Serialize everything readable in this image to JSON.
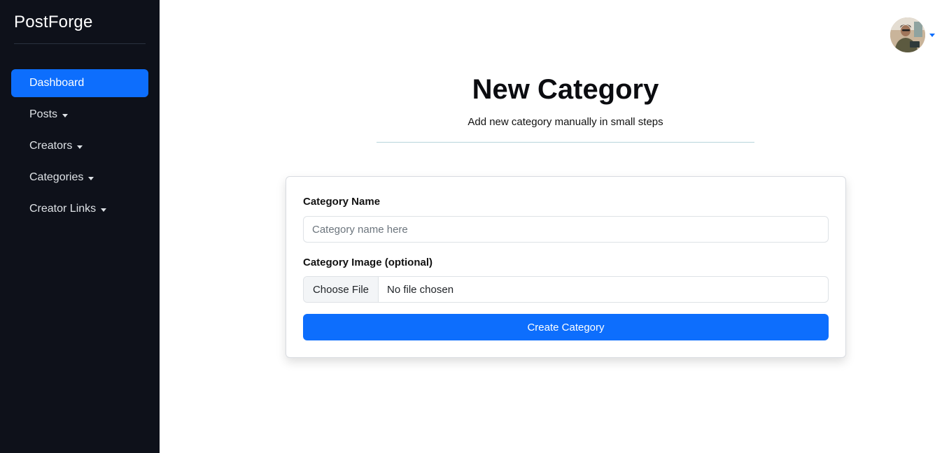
{
  "app": {
    "brand": "PostForge"
  },
  "sidebar": {
    "items": [
      {
        "label": "Dashboard",
        "active": true,
        "has_dropdown": false
      },
      {
        "label": "Posts",
        "active": false,
        "has_dropdown": true
      },
      {
        "label": "Creators",
        "active": false,
        "has_dropdown": true
      },
      {
        "label": "Categories",
        "active": false,
        "has_dropdown": true
      },
      {
        "label": "Creator Links",
        "active": false,
        "has_dropdown": true
      }
    ]
  },
  "header": {
    "title": "New Category",
    "subtitle": "Add new category manually in small steps"
  },
  "form": {
    "name_label": "Category Name",
    "name_placeholder": "Category name here",
    "name_value": "",
    "image_label": "Category Image (optional)",
    "file_button": "Choose File",
    "file_status": "No file chosen",
    "submit_label": "Create Category"
  },
  "user_menu": {
    "avatar_icon": "user-avatar",
    "dropdown_icon": "caret-down-icon"
  },
  "colors": {
    "sidebar_bg": "#0e111a",
    "accent": "#0d6efd",
    "divider": "#b8d4dc"
  }
}
